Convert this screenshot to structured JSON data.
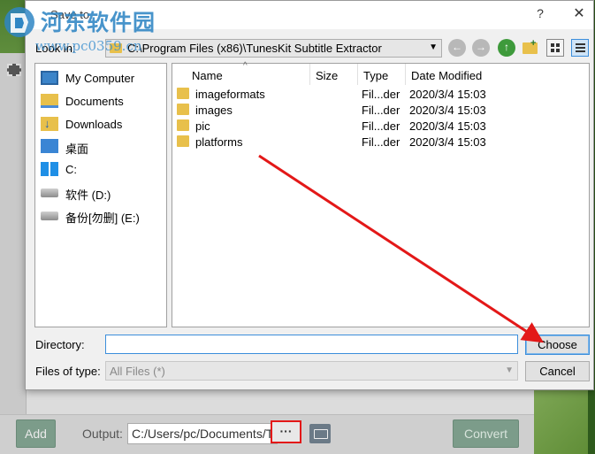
{
  "watermark": {
    "text": "河东软件园",
    "url": "www.pc0359.cn"
  },
  "dialog": {
    "title": "Save to",
    "help": "?",
    "close": "✕",
    "look_in_label": "Look in:",
    "look_in_value": "C:\\Program Files (x86)\\TunesKit Subtitle Extractor",
    "sidebar": [
      {
        "label": "My Computer",
        "icon": "computer-icon"
      },
      {
        "label": "Documents",
        "icon": "documents-folder-icon"
      },
      {
        "label": "Downloads",
        "icon": "downloads-folder-icon"
      },
      {
        "label": "桌面",
        "icon": "desktop-folder-icon"
      },
      {
        "label": "C:",
        "icon": "windows-drive-icon"
      },
      {
        "label": "软件 (D:)",
        "icon": "drive-icon"
      },
      {
        "label": "备份[勿删] (E:)",
        "icon": "drive-icon"
      }
    ],
    "columns": {
      "name": "Name",
      "size": "Size",
      "type": "Type",
      "modified": "Date Modified"
    },
    "files": [
      {
        "name": "imageformats",
        "size": "",
        "type": "Fil...der",
        "modified": "2020/3/4 15:03"
      },
      {
        "name": "images",
        "size": "",
        "type": "Fil...der",
        "modified": "2020/3/4 15:03"
      },
      {
        "name": "pic",
        "size": "",
        "type": "Fil...der",
        "modified": "2020/3/4 15:03"
      },
      {
        "name": "platforms",
        "size": "",
        "type": "Fil...der",
        "modified": "2020/3/4 15:03"
      }
    ],
    "directory_label": "Directory:",
    "directory_value": "",
    "choose_label": "Choose",
    "files_of_type_label": "Files of type:",
    "files_of_type_value": "All Files (*)",
    "cancel_label": "Cancel"
  },
  "app": {
    "add_label": "Add",
    "output_label": "Output:",
    "output_value": "C:/Users/pc/Documents/T",
    "more_label": "···",
    "convert_label": "Convert"
  },
  "colors": {
    "annotation_red": "#e31818",
    "accent_blue": "#3c8edb",
    "button_teal": "#7c9c8a"
  }
}
